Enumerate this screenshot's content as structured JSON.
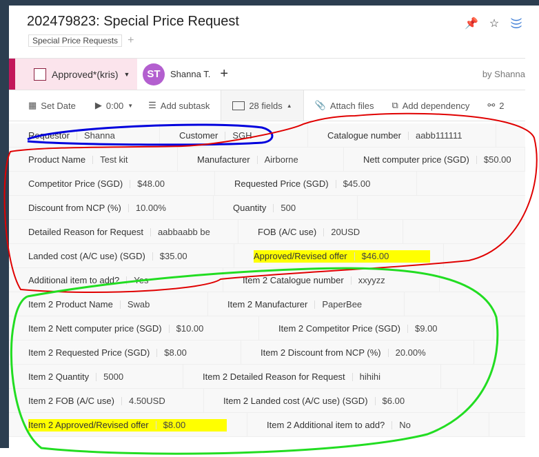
{
  "header": {
    "title": "202479823: Special Price Request",
    "tag": "Special Price Requests",
    "add_tag": "+",
    "icons": [
      "pin-icon",
      "star-icon",
      "rss-icon"
    ]
  },
  "status": {
    "label": "Approved*(kris)",
    "avatar_initials": "ST",
    "assignee": "Shanna T.",
    "add": "+",
    "author": "by Shanna"
  },
  "toolbar": {
    "set_date": "Set Date",
    "timer": "0:00",
    "add_subtask": "Add subtask",
    "fields": "28 fields",
    "attach": "Attach files",
    "dependency": "Add dependency",
    "share_count": "2"
  },
  "rows": [
    [
      {
        "l": "Requestor",
        "v": "Shanna"
      },
      {
        "l": "Customer",
        "v": "SGH"
      },
      {
        "l": "Catalogue number",
        "v": "aabb111111"
      }
    ],
    [
      {
        "l": "Product Name",
        "v": "Test kit"
      },
      {
        "l": "Manufacturer",
        "v": "Airborne"
      },
      {
        "l": "Nett computer price (SGD)",
        "v": "$50.00"
      }
    ],
    [
      {
        "l": "Competitor Price (SGD)",
        "v": "$48.00"
      },
      {
        "l": "Requested Price (SGD)",
        "v": "$45.00"
      }
    ],
    [
      {
        "l": "Discount from NCP (%)",
        "v": "10.00%"
      },
      {
        "l": "Quantity",
        "v": "500"
      }
    ],
    [
      {
        "l": "Detailed Reason for Request",
        "v": "aabbaabb be"
      },
      {
        "l": "FOB (A/C use)",
        "v": "20USD"
      }
    ],
    [
      {
        "l": "Landed cost (A/C use) (SGD)",
        "v": "$35.00"
      },
      {
        "l": "Approved/Revised offer",
        "v": "$46.00",
        "highlight": true
      }
    ],
    [
      {
        "l": "Additional item to add?",
        "v": "Yes"
      },
      {
        "l": "Item 2 Catalogue number",
        "v": "xxyyzz"
      }
    ],
    [
      {
        "l": "Item 2 Product Name",
        "v": "Swab"
      },
      {
        "l": "Item 2 Manufacturer",
        "v": "PaperBee"
      }
    ],
    [
      {
        "l": "Item 2 Nett computer price (SGD)",
        "v": "$10.00"
      },
      {
        "l": "Item 2 Competitor Price (SGD)",
        "v": "$9.00"
      }
    ],
    [
      {
        "l": "Item 2 Requested Price (SGD)",
        "v": "$8.00"
      },
      {
        "l": "Item 2 Discount from NCP (%)",
        "v": "20.00%"
      }
    ],
    [
      {
        "l": "Item 2 Quantity",
        "v": "5000"
      },
      {
        "l": "Item 2 Detailed Reason for Request",
        "v": "hihihi"
      }
    ],
    [
      {
        "l": "Item 2 FOB (A/C use)",
        "v": "4.50USD"
      },
      {
        "l": "Item 2 Landed cost (A/C use) (SGD)",
        "v": "$6.00"
      }
    ],
    [
      {
        "l": "Item 2 Approved/Revised offer",
        "v": "$8.00",
        "highlight": true
      },
      {
        "l": "Item 2 Additional item to add?",
        "v": "No"
      }
    ]
  ]
}
